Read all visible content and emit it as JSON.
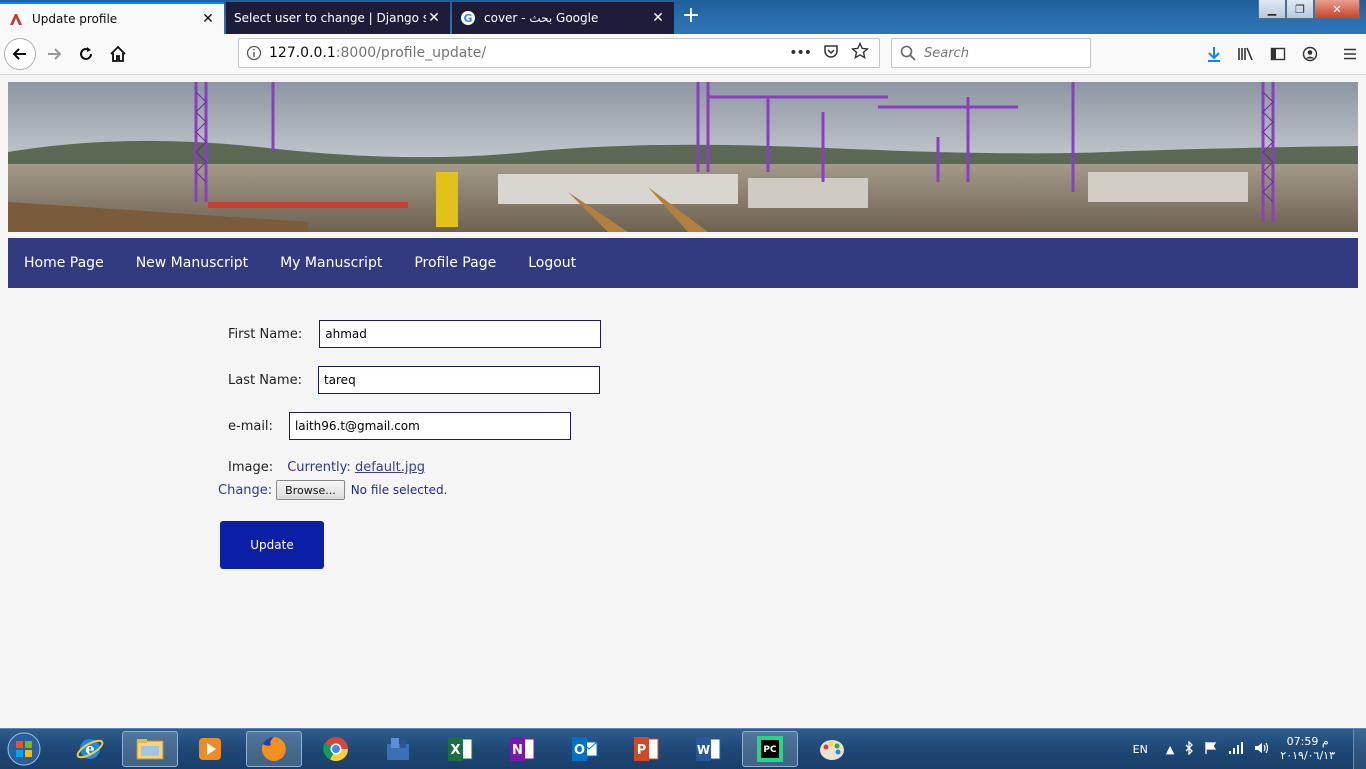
{
  "browser": {
    "tabs": [
      {
        "label": "Update profile",
        "active": true,
        "favicon": "django-icon"
      },
      {
        "label": "Select user to change | Django site a",
        "active": false,
        "favicon": "none"
      },
      {
        "label": "cover - بحث Google",
        "active": false,
        "favicon": "google-icon"
      }
    ],
    "new_tab": "+",
    "url_host": "127.0.0.1",
    "url_rest": ":8000/profile_update/",
    "url_more": "•••",
    "search_placeholder": "Search"
  },
  "site": {
    "menu": [
      {
        "label": "Home Page"
      },
      {
        "label": "New Manuscript"
      },
      {
        "label": "My Manuscript"
      },
      {
        "label": "Profile Page"
      },
      {
        "label": "Logout"
      }
    ]
  },
  "form": {
    "first_name_label": "First Name:",
    "first_name_value": "ahmad",
    "last_name_label": "Last Name:",
    "last_name_value": "tareq",
    "email_label": "e-mail:",
    "email_value": "laith96.t@gmail.com",
    "image_label": "Image:",
    "currently_label": "Currently:",
    "current_file": "default.jpg",
    "change_label": "Change:",
    "browse_label": "Browse...",
    "no_file": "No file selected.",
    "update_label": "Update"
  },
  "taskbar": {
    "apps": [
      "ie-icon",
      "explorer-icon",
      "media-player-icon",
      "firefox-icon",
      "chrome-icon",
      "app-icon",
      "excel-icon",
      "onenote-icon",
      "outlook-icon",
      "powerpoint-icon",
      "word-icon",
      "pycharm-icon",
      "paint-icon"
    ],
    "lang": "EN",
    "time": "07:59 م",
    "date": "٢٠١٩/٠٦/١٣"
  },
  "colors": {
    "menu_bg": "#343a80",
    "update_btn": "#0d1fa6",
    "link": "#3d3d9c"
  }
}
